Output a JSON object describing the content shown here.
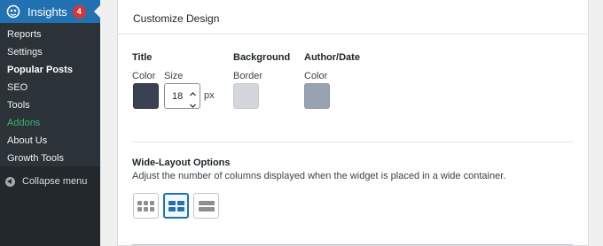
{
  "sidebar": {
    "app_title": "Insights",
    "badge_count": "4",
    "items": [
      {
        "label": "Reports"
      },
      {
        "label": "Settings"
      },
      {
        "label": "Popular Posts"
      },
      {
        "label": "SEO"
      },
      {
        "label": "Tools"
      },
      {
        "label": "Addons"
      },
      {
        "label": "About Us"
      },
      {
        "label": "Growth Tools"
      }
    ],
    "collapse_label": "Collapse menu"
  },
  "panel": {
    "title": "Customize Design",
    "title_section": {
      "heading": "Title",
      "color_label": "Color",
      "size_label": "Size",
      "size_value": "18",
      "size_unit": "px",
      "color_value": "#3a4152"
    },
    "background_section": {
      "heading": "Background",
      "border_label": "Border",
      "color_value": "#d3d7dd"
    },
    "author_section": {
      "heading": "Author/Date",
      "color_label": "Color",
      "color_value": "#99a2b3"
    },
    "wide_layout": {
      "heading": "Wide-Layout Options",
      "description": "Adjust the number of columns displayed when the widget is placed in a wide container.",
      "options": [
        {
          "name": "three-columns",
          "selected": false
        },
        {
          "name": "two-columns",
          "selected": true
        },
        {
          "name": "one-column",
          "selected": false
        }
      ]
    }
  },
  "colors": {
    "accent": "#2271b1",
    "addons": "#3bb371",
    "badge": "#d63638"
  }
}
